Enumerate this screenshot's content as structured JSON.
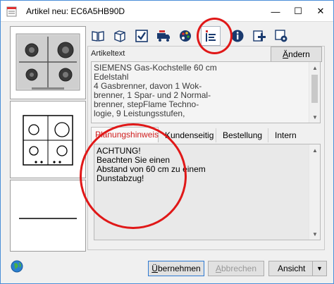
{
  "window": {
    "title": "Artikel neu: EC6A5HB90D",
    "min_glyph": "—",
    "max_glyph": "☐",
    "close_glyph": "✕"
  },
  "toolbar": {
    "icons": [
      "book-icon",
      "box-icon",
      "checkbox-icon",
      "truck-icon",
      "palette-icon",
      "list-notes-icon",
      "info-icon",
      "add-item-icon",
      "settings-box-icon"
    ],
    "active_icon": "list-notes-icon"
  },
  "artikeltext": {
    "label": "Artikeltext",
    "aendern_button": {
      "pre": "",
      "ul": "Ä",
      "post": "ndern"
    },
    "lines": [
      "SIEMENS Gas-Kochstelle 60 cm",
      "Edelstahl",
      "4 Gasbrenner, davon 1 Wok-",
      "brenner, 1 Spar- und 2 Normal-",
      "brenner, stepFlame Techno-",
      "logie, 9 Leistungsstufen,"
    ]
  },
  "tabs": [
    {
      "label": "Planungshinweis",
      "active": true
    },
    {
      "label": "Kundenseitig",
      "active": false
    },
    {
      "label": "Bestellung",
      "active": false
    },
    {
      "label": "Intern",
      "active": false
    }
  ],
  "hinweis": {
    "lines": [
      "ACHTUNG!",
      "Beachten Sie einen",
      "Abstand von 60 cm zu einem",
      "Dunstabzug!"
    ]
  },
  "buttons": {
    "uebernehmen": {
      "pre": "",
      "ul": "Ü",
      "post": "bernehmen"
    },
    "abbrechen": {
      "pre": "",
      "ul": "A",
      "post": "bbrechen",
      "enabled": false
    },
    "ansicht": "Ansicht"
  },
  "colors": {
    "accent": "#2e7ad2",
    "highlight_ring": "#e01818",
    "active_tab_text": "#d02020"
  }
}
